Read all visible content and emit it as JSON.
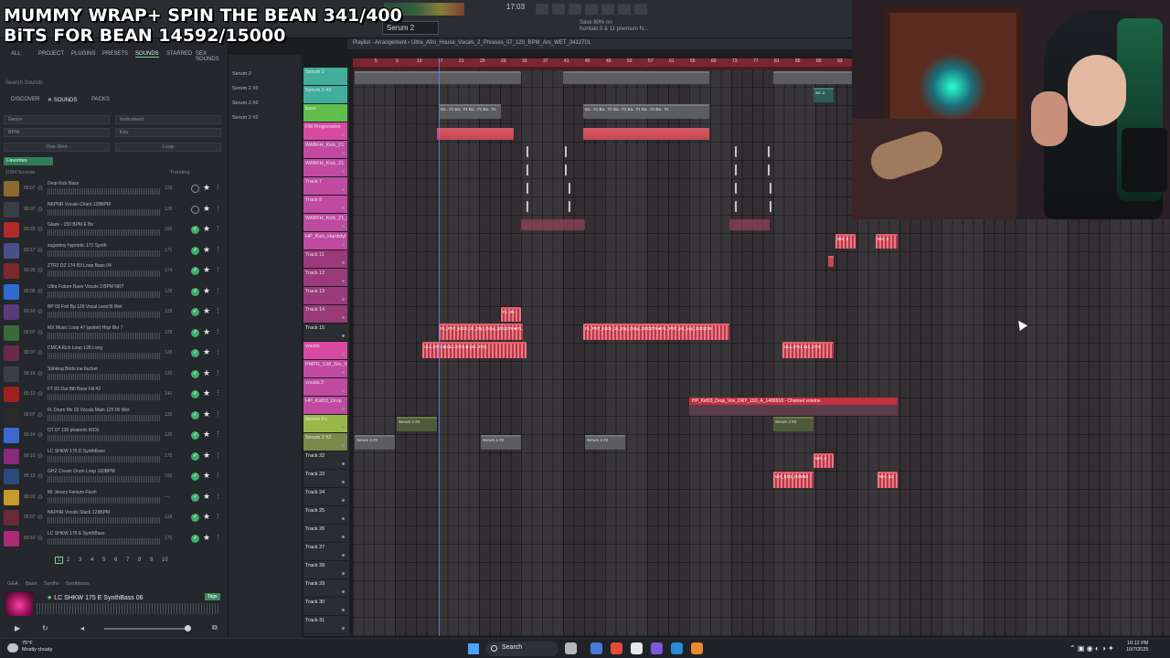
{
  "overlay": {
    "line1": "MUMMY WRAP+ SPIN THE BEAN 341/400",
    "line2": "BiTS FOR BEAN 14592/15000"
  },
  "toolbar": {
    "pattern": "Serum 2",
    "time": "17:03",
    "info_line1": "Save 80% on",
    "info_line2": "Kontakt 8 & 11 premium N..."
  },
  "browser": {
    "tabs": [
      "ALL",
      "PROJECT",
      "PLUGINS",
      "PRESETS",
      "SOUNDS",
      "STARRED",
      "SEX SOUNDS"
    ],
    "active_tab": "SOUNDS",
    "search_placeholder": "Search Sounds",
    "subtabs": [
      "DISCOVER",
      "✕ SOUNDS",
      "PACKS"
    ],
    "filters": [
      "Genre",
      "Instrument",
      "BPM",
      "Key",
      "One-Shot",
      "Loop"
    ],
    "favorites_label": "Favorites",
    "count_label": "1084 Sounds",
    "sort_label": "Trending",
    "sounds": [
      {
        "dur": "00:07",
        "name": "Drop Kick Bass",
        "meta": "128",
        "color": "#8b6a2e",
        "checked": false
      },
      {
        "dur": "00:07",
        "name": "NKPNR Vocals Chant 128BPM",
        "meta": "128",
        "color": "#3a3f47",
        "checked": false
      },
      {
        "dur": "00:25",
        "name": "Glaze - 150 BPM E Bs",
        "meta": "150",
        "color": "#b02a2a",
        "checked": true
      },
      {
        "dur": "00:17",
        "name": "sugarboy hypnotic 171 Synth",
        "meta": "171",
        "color": "#4a4f8a",
        "checked": true
      },
      {
        "dur": "00:28",
        "name": "ZTR2 DZ 174 B3 Loop Bass 04",
        "meta": "174",
        "color": "#7a2a2a",
        "checked": true
      },
      {
        "dur": "00:05",
        "name": "Ultra Future Rave Vocals 3 BPM NRT",
        "meta": "128",
        "color": "#2f6ad0",
        "checked": true
      },
      {
        "dur": "00:16",
        "name": "BP 03 Fml Bp 128 Vocal Lead B Wet",
        "meta": "128",
        "color": "#5a3a7a",
        "checked": true
      },
      {
        "dur": "00:07",
        "name": "MX Music Loop 47 (potlet) Hrgr Bkr 7",
        "meta": "128",
        "color": "#3a6a3a",
        "checked": true
      },
      {
        "dur": "00:07",
        "name": "CMCA Kick Loop 128 Long",
        "meta": "128",
        "color": "#6a2a4a",
        "checked": true
      },
      {
        "dur": "00:16",
        "name": "Stinking Birds ine bucket",
        "meta": "130",
        "color": "#3a3f47",
        "checked": true
      },
      {
        "dur": "00:13",
        "name": "FT 65 Dur 8th Bass Fill 42",
        "meta": "140",
        "color": "#a02020",
        "checked": true
      },
      {
        "dur": "00:07",
        "name": "FL Drum Mx 02 Vocals Main 125 06 Wet",
        "meta": "125",
        "color": "#2a2a2a",
        "checked": true
      },
      {
        "dur": "00:14",
        "name": "DT 07 130 phatonic KICK",
        "meta": "130",
        "color": "#3a6ad0",
        "checked": true
      },
      {
        "dur": "00:10",
        "name": "LC SHKW 175 D SynthBass",
        "meta": "175",
        "color": "#8a2a7a",
        "checked": true
      },
      {
        "dur": "00:13",
        "name": "GHZ Cream Drum Loop 160BPM",
        "meta": "160",
        "color": "#2a4a7a",
        "checked": true
      },
      {
        "dur": "00:01",
        "name": "Mr Jersey Fenium Flush",
        "meta": "—",
        "color": "#c89a2a",
        "checked": true
      },
      {
        "dur": "00:07",
        "name": "NKPNR Vocals Stack 128BPM",
        "meta": "128",
        "color": "#6a2a3a",
        "checked": true
      },
      {
        "dur": "00:10",
        "name": "LC SHKW 175 E SynthBass",
        "meta": "175",
        "color": "#b02a7a",
        "checked": true
      }
    ],
    "pages": [
      "1",
      "2",
      "3",
      "4",
      "5",
      "6",
      "7",
      "8",
      "9",
      "10"
    ],
    "active_page": "1",
    "bottom_tabs": [
      "G&A",
      "Bass",
      "Synths",
      "Synthbass"
    ],
    "preview_name": "LC SHKW 175 E SynthBass 06",
    "preview_tag": "Tags"
  },
  "channels": [
    "Serum 2",
    "Serum 2 #3",
    "Serum 2 #2",
    "Serum 2 #2"
  ],
  "playlist": {
    "title": "Playlist - Arrangement › Ultra_Afro_House_Vocals_2_Phrases_07_120_BPM_Am_WET_3412701",
    "ruler": [
      "5",
      "9",
      "13",
      "17",
      "21",
      "25",
      "29",
      "33",
      "37",
      "41",
      "45",
      "49",
      "53",
      "57",
      "61",
      "65",
      "69",
      "73",
      "77",
      "81",
      "85",
      "89",
      "93"
    ],
    "tracks": [
      {
        "name": "Serum 2",
        "color": "#3fae9a"
      },
      {
        "name": "Serum 2 #3",
        "color": "#3fae9a"
      },
      {
        "name": "bass",
        "color": "#5fbf4a"
      },
      {
        "name": "FM Progressive",
        "color": "#d84aa0"
      },
      {
        "name": "WABFH_Kick_21",
        "color": "#c04aa0"
      },
      {
        "name": "WABFH_Kick_21",
        "color": "#c04aa0"
      },
      {
        "name": "Track 7",
        "color": "#c04aa0"
      },
      {
        "name": "Track 8",
        "color": "#c04aa0"
      },
      {
        "name": "WABFH_Kick_21_B",
        "color": "#c04aa0"
      },
      {
        "name": "HP_Kick_Hardstyl",
        "color": "#c04aa0"
      },
      {
        "name": "Track 11",
        "color": "#9a3a7a"
      },
      {
        "name": "Track 12",
        "color": "#9a3a7a"
      },
      {
        "name": "Track 13",
        "color": "#9a3a7a"
      },
      {
        "name": "Track 14",
        "color": "#9a3a7a"
      },
      {
        "name": "Track 15",
        "color": "#2a2d31"
      },
      {
        "name": "vocals",
        "color": "#d84aa0"
      },
      {
        "name": "PMPR_138_Sm_V",
        "color": "#c04aa0"
      },
      {
        "name": "vocals 2",
        "color": "#c04aa0"
      },
      {
        "name": "HP_Kid03_Drop",
        "color": "#c04aa0"
      },
      {
        "name": "Serum Fx",
        "color": "#9ab84a"
      },
      {
        "name": "Serum 2 #2",
        "color": "#7a8a4a"
      },
      {
        "name": "Track 22",
        "color": "#2a2d31"
      },
      {
        "name": "Track 23",
        "color": "#2a2d31"
      },
      {
        "name": "Track 24",
        "color": "#2a2d31"
      },
      {
        "name": "Track 25",
        "color": "#2a2d31"
      },
      {
        "name": "Track 26",
        "color": "#2a2d31"
      },
      {
        "name": "Track 27",
        "color": "#2a2d31"
      },
      {
        "name": "Track 28",
        "color": "#2a2d31"
      },
      {
        "name": "Track 29",
        "color": "#2a2d31"
      },
      {
        "name": "Track 30",
        "color": "#2a2d31"
      },
      {
        "name": "Track 31",
        "color": "#2a2d31"
      }
    ],
    "clip_labels": {
      "se2": "Se..2",
      "bass": "Ba.. #1 Ba.. #1 Ba.. #1 Ba.. #1",
      "bass_b": "Ba.. #1 Ba.. #1 Ba.. #1 Ba.. #1 Ba.. #1 Ba.. #1",
      "wa3": "WA..3",
      "fl": "FL..#6",
      "zap": "FL_PST_Kit02_1k_Zap_Drop_2203279 ■ FL_PST_Kit02_1k_Zap_Drop_2203279",
      "zap_b": "FL_PST_Kit02_1k_Zap_Drop_2203279 ■ FL_PST_Kit_exp_2203279",
      "ult": "ULt..2701 ■ ULt..2701 ■ ULt..2701",
      "ult_b": "ULt..2701 ULt..2701",
      "automation": "HP_Kid03_Drop_Vox_DRY_150_A_1486918 - Channel volume",
      "serum22": "Serum 2 #2",
      "wa4": "WA..4",
      "wa_last": "WA_KN3_H3W83",
      "wa5": "WA..33"
    }
  },
  "taskbar": {
    "temp": "75°F",
    "weather": "Mostly cloudy",
    "search": "Search",
    "time": "10:12 PM",
    "date": "10/7/2025"
  }
}
